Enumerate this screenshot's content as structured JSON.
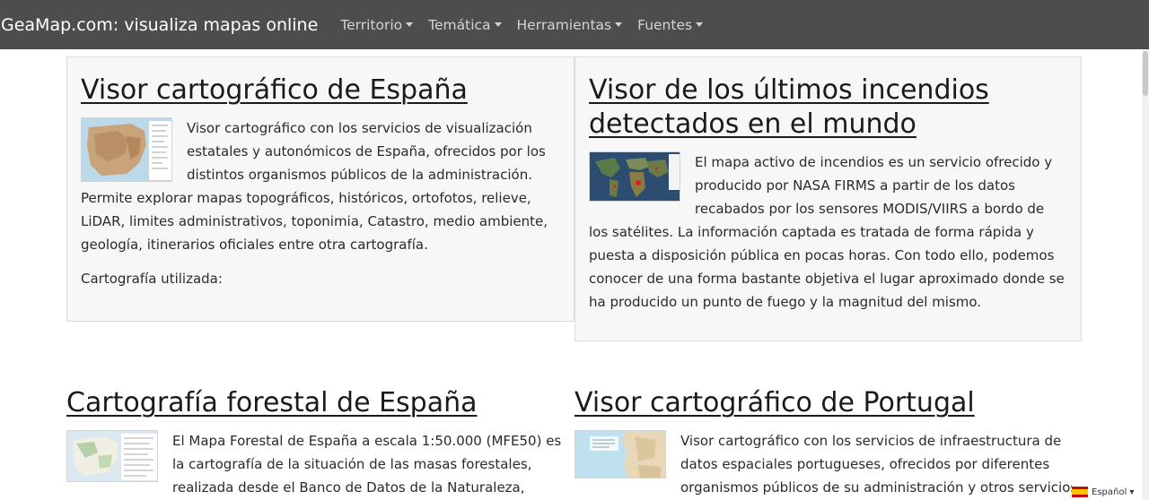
{
  "nav": {
    "brand": "GeaMap.com: visualiza mapas online",
    "items": [
      {
        "label": "Territorio"
      },
      {
        "label": "Temática"
      },
      {
        "label": "Herramientas"
      },
      {
        "label": "Fuentes"
      }
    ]
  },
  "cards": [
    {
      "title": "Visor cartográfico de España",
      "description": "Visor cartográfico con los servicios de visualización estatales y autonómicos de España, ofrecidos por los distintos organismos públicos de la administración. Permite explorar mapas topográficos, históricos, ortofotos, relieve, LiDAR, limites administrativos, toponimia, Catastro, medio ambiente, geología, itinerarios oficiales entre otra cartografía.",
      "subtitle": "Cartografía utilizada:"
    },
    {
      "title": "Visor de los últimos incendios detectados en el mundo",
      "description": "El mapa activo de incendios es un servicio ofrecido y producido por NASA FIRMS a partir de los datos recabados por los sensores MODIS/VIIRS a bordo de los satélites. La información captada es tratada de forma rápida y puesta a disposición pública en pocas horas. Con todo ello, podemos conocer de una forma bastante objetiva el lugar aproximado donde se ha producido un punto de fuego y la magnitud del mismo."
    },
    {
      "title": "Cartografía forestal de España",
      "description": "El Mapa Forestal de España a escala 1:50.000 (MFE50) es la cartografía de la situación de las masas forestales, realizada desde el Banco de Datos de la Naturaleza, siguiendo un"
    },
    {
      "title": "Visor cartográfico de Portugal",
      "description": "Visor cartográfico con los servicios de infraestructura de datos espaciales portugueses, ofrecidos por diferentes organismos públicos de su administración y otros servicios de distribución"
    }
  ],
  "language": {
    "label": "Español ▾"
  },
  "colors": {
    "navbar": "#4d4d4d",
    "card_bg": "#f7f7f7",
    "card_border": "#dcdcdc"
  }
}
